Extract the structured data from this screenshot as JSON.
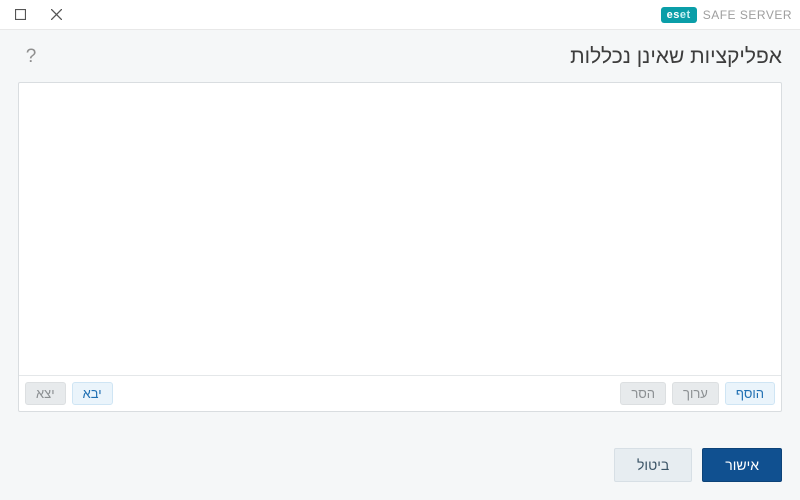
{
  "brand": {
    "logo_text": "eset",
    "product": "SAFE SERVER"
  },
  "header": {
    "title": "אפליקציות שאינן נכללות",
    "help": "?"
  },
  "toolbar": {
    "add": "הוסף",
    "edit": "ערוך",
    "remove": "הסר",
    "import": "יבא",
    "export": "יצא"
  },
  "footer": {
    "ok": "אישור",
    "cancel": "ביטול"
  }
}
